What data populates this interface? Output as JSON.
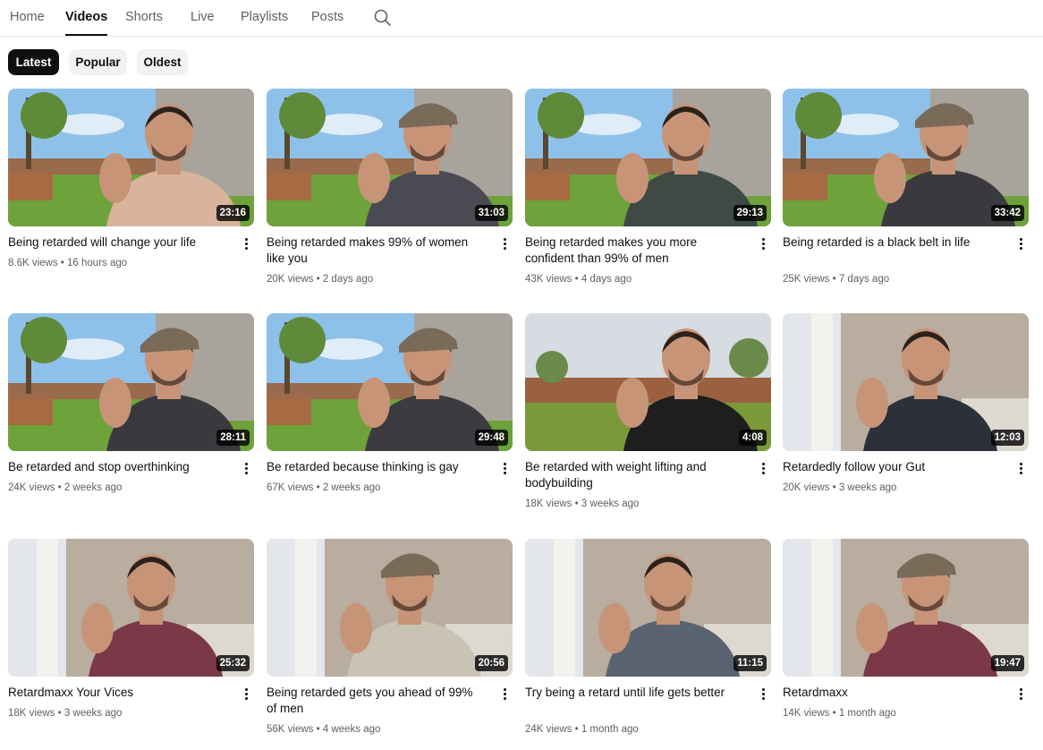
{
  "tabs": [
    {
      "label": "Home",
      "active": false
    },
    {
      "label": "Videos",
      "active": true
    },
    {
      "label": "Shorts",
      "active": false
    },
    {
      "label": "Live",
      "active": false
    },
    {
      "label": "Playlists",
      "active": false
    },
    {
      "label": "Posts",
      "active": false
    }
  ],
  "search_icon": "search-icon",
  "chips": [
    {
      "label": "Latest",
      "active": true
    },
    {
      "label": "Popular",
      "active": false
    },
    {
      "label": "Oldest",
      "active": false
    }
  ],
  "videos": [
    {
      "title": "Being retarded will change your life",
      "views": "8.6K views",
      "age": "16 hours ago",
      "duration": "23:16",
      "scene": "outdoor",
      "shirt": "#d8b49c",
      "cap": false
    },
    {
      "title": "Being retarded makes 99% of women like you",
      "views": "20K views",
      "age": "2 days ago",
      "duration": "31:03",
      "scene": "outdoor",
      "shirt": "#4a4a52",
      "cap": true
    },
    {
      "title": "Being retarded makes you more confident than 99% of men",
      "views": "43K views",
      "age": "4 days ago",
      "duration": "29:13",
      "scene": "outdoor",
      "shirt": "#3f4a45",
      "cap": false
    },
    {
      "title": "Being retarded is a black belt in life",
      "views": "25K views",
      "age": "7 days ago",
      "duration": "33:42",
      "scene": "outdoor",
      "shirt": "#3a3a3e",
      "cap": true
    },
    {
      "title": "Be retarded and stop overthinking",
      "views": "24K views",
      "age": "2 weeks ago",
      "duration": "28:11",
      "scene": "outdoor",
      "shirt": "#3a3a3e",
      "cap": true
    },
    {
      "title": "Be retarded because thinking is gay",
      "views": "67K views",
      "age": "2 weeks ago",
      "duration": "29:48",
      "scene": "outdoor",
      "shirt": "#3c3c40",
      "cap": true
    },
    {
      "title": "Be retarded with weight lifting and bodybuilding",
      "views": "18K views",
      "age": "3 weeks ago",
      "duration": "4:08",
      "scene": "yard",
      "shirt": "#1e1e1e",
      "cap": false
    },
    {
      "title": "Retardedly follow your Gut",
      "views": "20K views",
      "age": "3 weeks ago",
      "duration": "12:03",
      "scene": "indoor",
      "shirt": "#2c3038",
      "cap": false
    },
    {
      "title": "Retardmaxx Your Vices",
      "views": "18K views",
      "age": "3 weeks ago",
      "duration": "25:32",
      "scene": "indoor",
      "shirt": "#7a3848",
      "cap": false
    },
    {
      "title": "Being retarded gets you ahead of 99% of men",
      "views": "56K views",
      "age": "4 weeks ago",
      "duration": "20:56",
      "scene": "indoor",
      "shirt": "#c9c3b4",
      "cap": true
    },
    {
      "title": "Try being a retard until life gets better",
      "views": "24K views",
      "age": "1 month ago",
      "duration": "11:15",
      "scene": "indoor",
      "shirt": "#5a6470",
      "cap": false
    },
    {
      "title": "Retardmaxx",
      "views": "14K views",
      "age": "1 month ago",
      "duration": "19:47",
      "scene": "indoor",
      "shirt": "#7a3848",
      "cap": true
    }
  ]
}
